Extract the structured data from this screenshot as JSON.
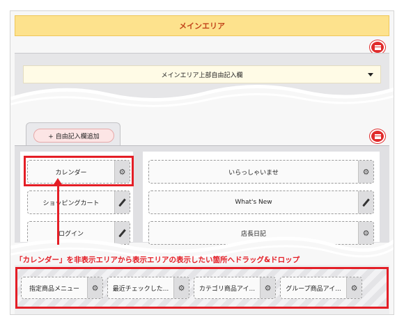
{
  "main_area": {
    "header": "メインエリア",
    "free_entry": "メインエリア上部自由記入欄"
  },
  "tab": {
    "add_free_entry": "+ 自由記入欄追加"
  },
  "left_column": [
    {
      "label": "カレンダー",
      "control": "gear-icon"
    },
    {
      "label": "ショッピングカート",
      "control": "pencil-icon"
    },
    {
      "label": "ログイン",
      "control": "pencil-icon"
    }
  ],
  "right_column": [
    {
      "label": "いらっしゃいませ",
      "control": "gear-icon"
    },
    {
      "label": "What's New",
      "control": "pencil-icon"
    },
    {
      "label": "店長日記",
      "control": "gear-icon"
    }
  ],
  "instruction": "「カレンダー」を非表示エリアから表示エリアの表示したい箇所へドラッグ&ドロップ",
  "hidden_blocks": [
    {
      "label": "指定商品メニュー",
      "control": "gear-icon"
    },
    {
      "label": "最近チェックした...",
      "control": "gear-icon"
    },
    {
      "label": "カテゴリ商品アイ...",
      "control": "gear-icon"
    },
    {
      "label": "グループ商品アイ...",
      "control": "gear-icon"
    }
  ],
  "colors": {
    "highlight": "#e41e26",
    "header_bg": "#fde28d",
    "header_text": "#c2451b",
    "comment_button": "#e02b2b"
  }
}
